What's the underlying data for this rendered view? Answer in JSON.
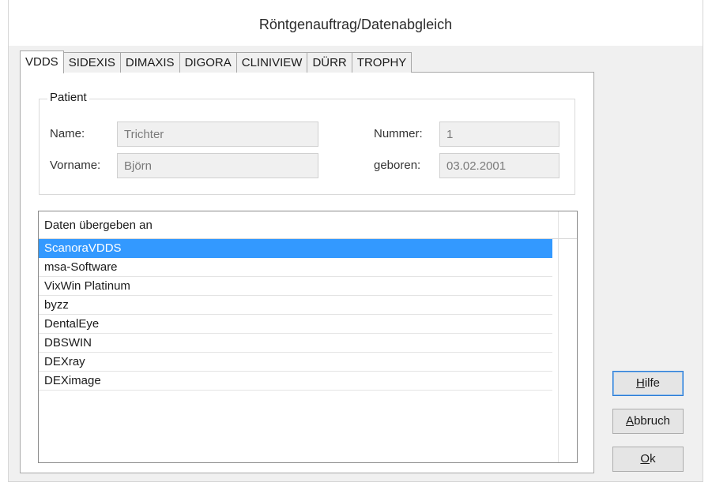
{
  "window": {
    "title": "Röntgenauftrag/Datenabgleich"
  },
  "tabs": [
    {
      "label": "VDDS",
      "active": true
    },
    {
      "label": "SIDEXIS",
      "active": false
    },
    {
      "label": "DIMAXIS",
      "active": false
    },
    {
      "label": "DIGORA",
      "active": false
    },
    {
      "label": "CLINIVIEW",
      "active": false
    },
    {
      "label": "DÜRR",
      "active": false
    },
    {
      "label": "TROPHY",
      "active": false
    }
  ],
  "patient": {
    "group_label": "Patient",
    "name_label": "Name:",
    "name_value": "Trichter",
    "vorname_label": "Vorname:",
    "vorname_value": "Björn",
    "nummer_label": "Nummer:",
    "nummer_value": "1",
    "geboren_label": "geboren:",
    "geboren_value": "03.02.2001"
  },
  "list": {
    "header": "Daten übergeben an",
    "items": [
      "ScanoraVDDS",
      "msa-Software",
      "VixWin Platinum",
      "byzz",
      "DentalEye",
      "DBSWIN",
      "DEXray",
      "DEXimage"
    ],
    "selected_index": 0
  },
  "buttons": {
    "hilfe": {
      "accel": "H",
      "rest": "ilfe"
    },
    "abbruch": {
      "accel": "A",
      "rest": "bbruch"
    },
    "ok": {
      "accel": "O",
      "rest": "k"
    }
  },
  "colors": {
    "selection": "#3399ff",
    "window_bg": "#f0f0f0",
    "default_button_border": "#2a7bd6"
  }
}
